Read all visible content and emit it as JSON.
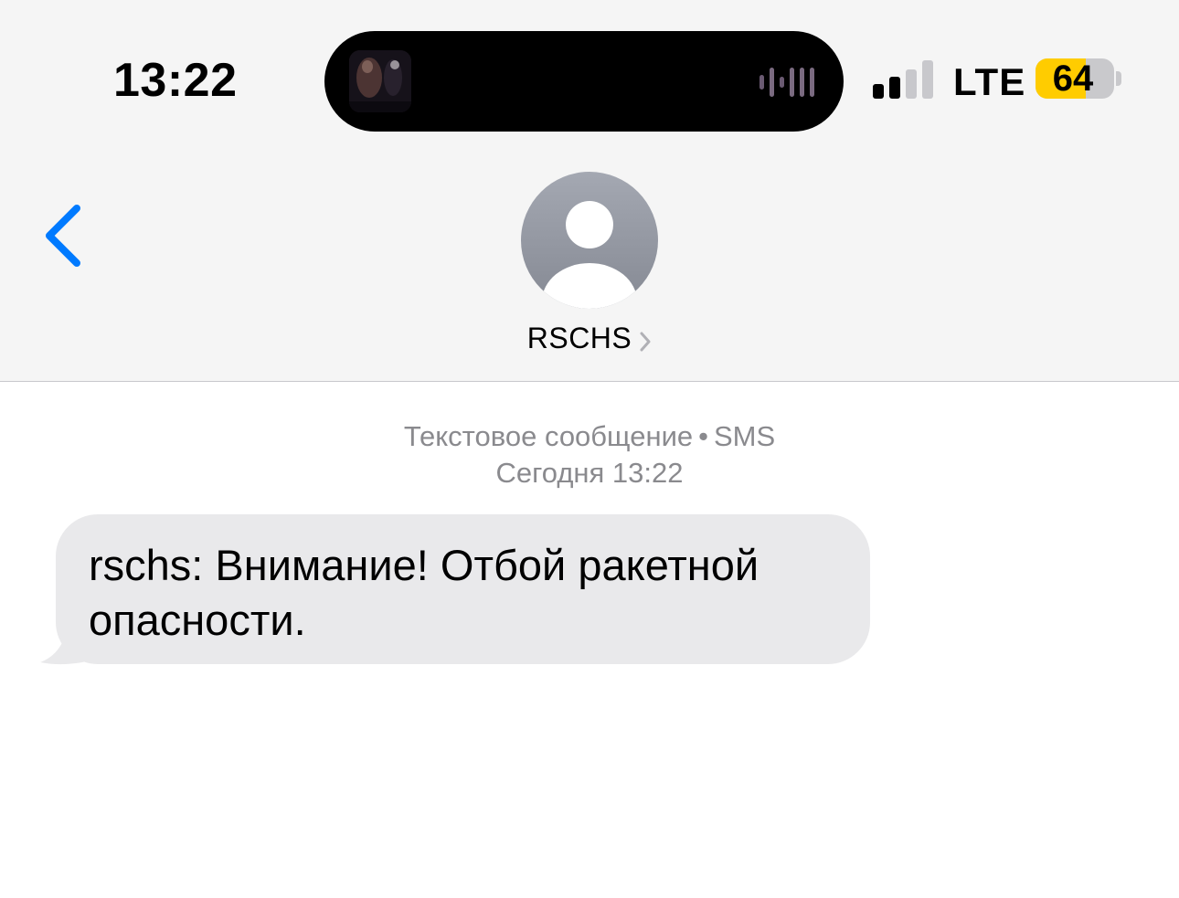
{
  "status_bar": {
    "time": "13:22",
    "network": "LTE",
    "battery_level": "64",
    "battery_fraction": 0.64,
    "signal_bars_active": 2,
    "signal_bars_total": 4,
    "battery_color": "#ffcc00"
  },
  "dynamic_island": {
    "now_playing_artwork": "album-art-thumbnail",
    "activity_icon": "audio-waveform-icon"
  },
  "nav": {
    "back_icon": "chevron-left-icon",
    "accent_color": "#007aff"
  },
  "contact": {
    "avatar_icon": "person-silhouette-icon",
    "name": "RSCHS",
    "disclosure_icon": "chevron-right-icon"
  },
  "thread": {
    "service_label": "Текстовое сообщение",
    "separator": "•",
    "service_type": "SMS",
    "timestamp": "Сегодня 13:22",
    "messages": [
      {
        "direction": "incoming",
        "text": "rschs: Внимание! Отбой ракетной опасности."
      }
    ]
  }
}
